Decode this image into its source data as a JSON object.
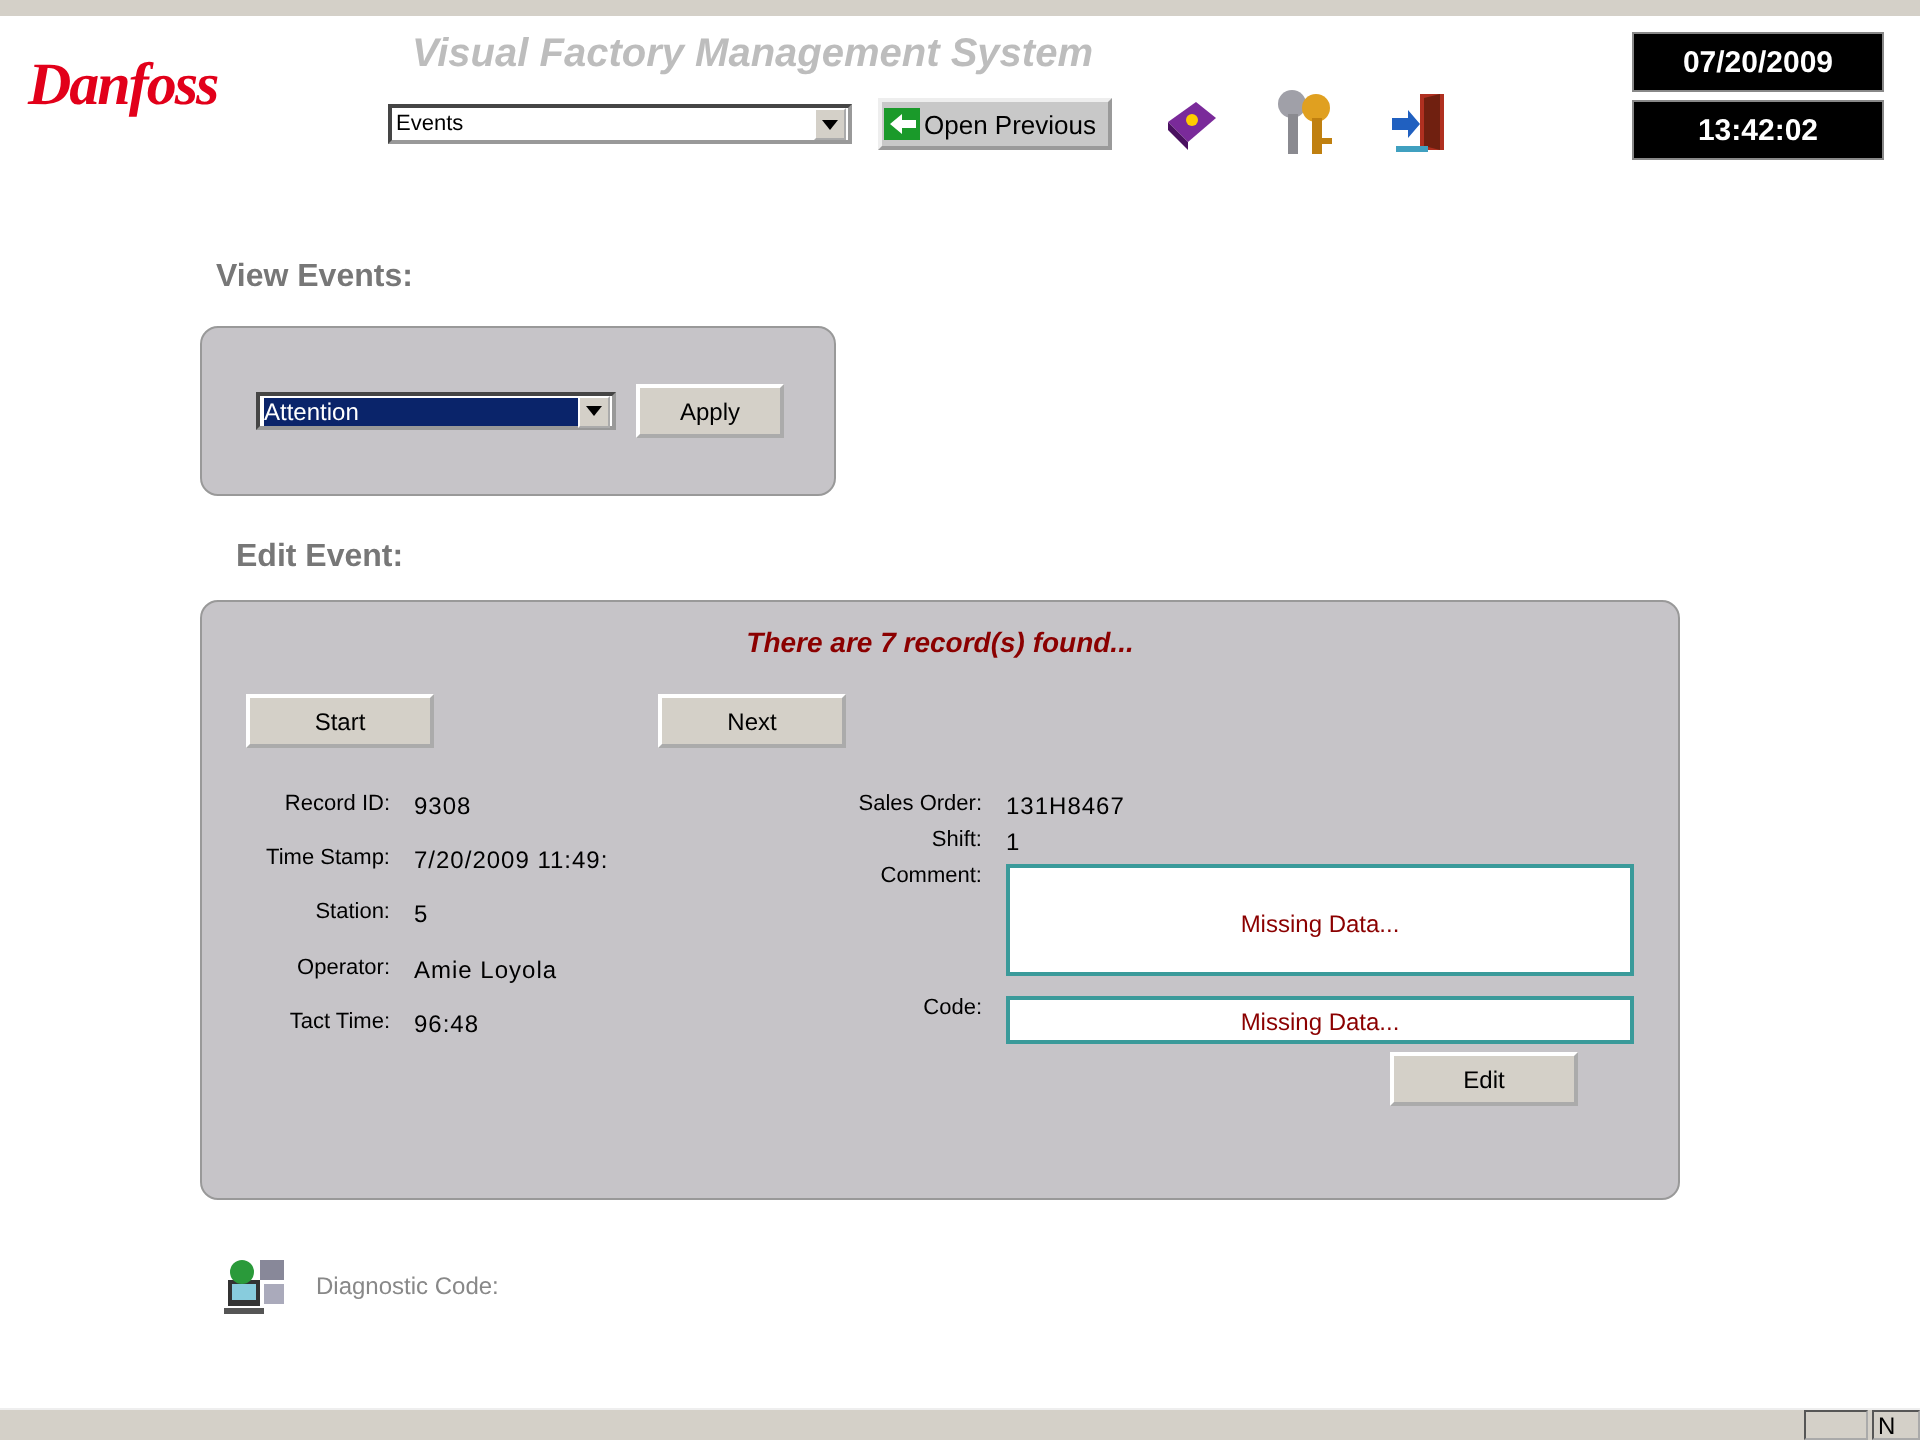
{
  "header": {
    "logo": "Danfoss",
    "title": "Visual Factory Management System",
    "screen_select": {
      "value": "Events"
    },
    "open_previous": "Open Previous",
    "date": "07/20/2009",
    "time": "13:42:02"
  },
  "view_events": {
    "heading": "View Events:",
    "filter": {
      "value": "Attention"
    },
    "apply": "Apply"
  },
  "edit_event": {
    "heading": "Edit Event:",
    "message": "There are 7 record(s) found...",
    "start": "Start",
    "next": "Next",
    "left_fields": [
      {
        "label": "Record ID:",
        "value": "9308"
      },
      {
        "label": "Time Stamp:",
        "value": "7/20/2009 11:49:"
      },
      {
        "label": "Station:",
        "value": "5"
      },
      {
        "label": "Operator:",
        "value": "Amie Loyola"
      },
      {
        "label": "Tact Time:",
        "value": "96:48"
      }
    ],
    "right_fields": [
      {
        "label": "Sales Order:",
        "value": "131H8467"
      },
      {
        "label": "Shift:",
        "value": "1"
      }
    ],
    "comment": {
      "label": "Comment:",
      "value": "Missing Data..."
    },
    "code": {
      "label": "Code:",
      "value": "Missing Data..."
    },
    "edit": "Edit"
  },
  "diagnostic": {
    "label": "Diagnostic Code:"
  },
  "status_bar": {
    "panels": [
      "N"
    ]
  }
}
